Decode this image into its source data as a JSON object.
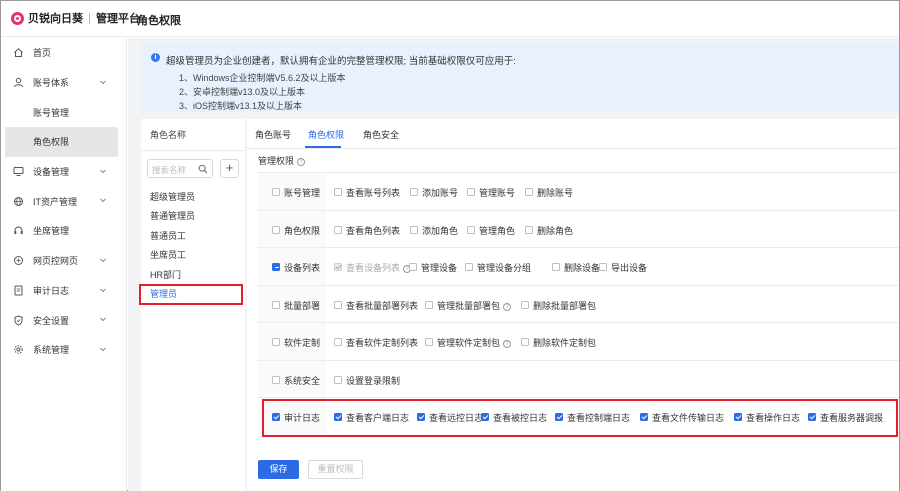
{
  "brand": {
    "name": "贝锐向日葵",
    "sub": "管理平台"
  },
  "page_title": "角色权限",
  "sidebar": {
    "items": [
      {
        "label": "首页",
        "icon": "home-icon",
        "type": "top",
        "chevron": false
      },
      {
        "label": "账号体系",
        "icon": "user-icon",
        "type": "top",
        "chevron": true
      },
      {
        "label": "账号管理",
        "type": "sub"
      },
      {
        "label": "角色权限",
        "type": "sub",
        "active": true
      },
      {
        "label": "设备管理",
        "icon": "monitor-icon",
        "type": "top",
        "chevron": true
      },
      {
        "label": "IT资产管理",
        "icon": "globe-icon",
        "type": "top",
        "chevron": true
      },
      {
        "label": "坐席管理",
        "icon": "headset-icon",
        "type": "top",
        "chevron": false
      },
      {
        "label": "网页控网页",
        "icon": "web-icon",
        "type": "top",
        "chevron": true
      },
      {
        "label": "审计日志",
        "icon": "document-icon",
        "type": "top",
        "chevron": true
      },
      {
        "label": "安全设置",
        "icon": "shield-icon",
        "type": "top",
        "chevron": true
      },
      {
        "label": "系统管理",
        "icon": "gear-icon",
        "type": "top",
        "chevron": true
      }
    ]
  },
  "notice": {
    "line1": "超级管理员为企业创建者，默认拥有企业的完整管理权限; 当前基础权限仅可应用于:",
    "items": [
      "1、Windows企业控制端V5.6.2及以上版本",
      "2、安卓控制端v13.0及以上版本",
      "3、iOS控制端v13.1及以上版本"
    ]
  },
  "role_panel": {
    "header": "角色名称",
    "search_placeholder": "搜索名称",
    "add_label": "+",
    "roles": [
      "超级管理员",
      "普通管理员",
      "普通员工",
      "坐席员工",
      "HR部门",
      "管理员"
    ],
    "active_index": 5
  },
  "tabs": [
    "角色账号",
    "角色权限",
    "角色安全"
  ],
  "active_tab": 1,
  "perm_title": "管理权限",
  "perm_rows": [
    {
      "category": "账号管理",
      "state": "none",
      "perms": [
        {
          "label": "查看账号列表",
          "state": "none"
        },
        {
          "label": "添加账号",
          "state": "none"
        },
        {
          "label": "管理账号",
          "state": "none"
        },
        {
          "label": "删除账号",
          "state": "none"
        }
      ]
    },
    {
      "category": "角色权限",
      "state": "none",
      "perms": [
        {
          "label": "查看角色列表",
          "state": "none"
        },
        {
          "label": "添加角色",
          "state": "none"
        },
        {
          "label": "管理角色",
          "state": "none"
        },
        {
          "label": "删除角色",
          "state": "none"
        }
      ]
    },
    {
      "category": "设备列表",
      "state": "partial",
      "perms": [
        {
          "label": "查看设备列表",
          "state": "disabled-checked",
          "help": true
        },
        {
          "label": "管理设备",
          "state": "none"
        },
        {
          "label": "管理设备分组",
          "state": "none"
        },
        {
          "label": "删除设备",
          "state": "none"
        },
        {
          "label": "导出设备",
          "state": "none"
        }
      ]
    },
    {
      "category": "批量部署",
      "state": "none",
      "perms": [
        {
          "label": "查看批量部署列表",
          "state": "none"
        },
        {
          "label": "管理批量部署包",
          "state": "none",
          "help": true
        },
        {
          "label": "删除批量部署包",
          "state": "none"
        }
      ]
    },
    {
      "category": "软件定制",
      "state": "none",
      "perms": [
        {
          "label": "查看软件定制列表",
          "state": "none"
        },
        {
          "label": "管理软件定制包",
          "state": "none",
          "help": true
        },
        {
          "label": "删除软件定制包",
          "state": "none"
        }
      ]
    },
    {
      "category": "系统安全",
      "state": "none",
      "perms": [
        {
          "label": "设置登录限制",
          "state": "none"
        }
      ]
    },
    {
      "category": "审计日志",
      "state": "checked",
      "perms": [
        {
          "label": "查看客户端日志",
          "state": "checked"
        },
        {
          "label": "查看远控日志",
          "state": "checked"
        },
        {
          "label": "查看被控日志",
          "state": "checked"
        },
        {
          "label": "查看控制端日志",
          "state": "checked"
        },
        {
          "label": "查看文件传输日志",
          "state": "checked"
        },
        {
          "label": "查看操作日志",
          "state": "checked"
        },
        {
          "label": "查看服务器调报",
          "state": "checked"
        }
      ]
    }
  ],
  "buttons": {
    "save": "保存",
    "reset": "重置权限"
  }
}
